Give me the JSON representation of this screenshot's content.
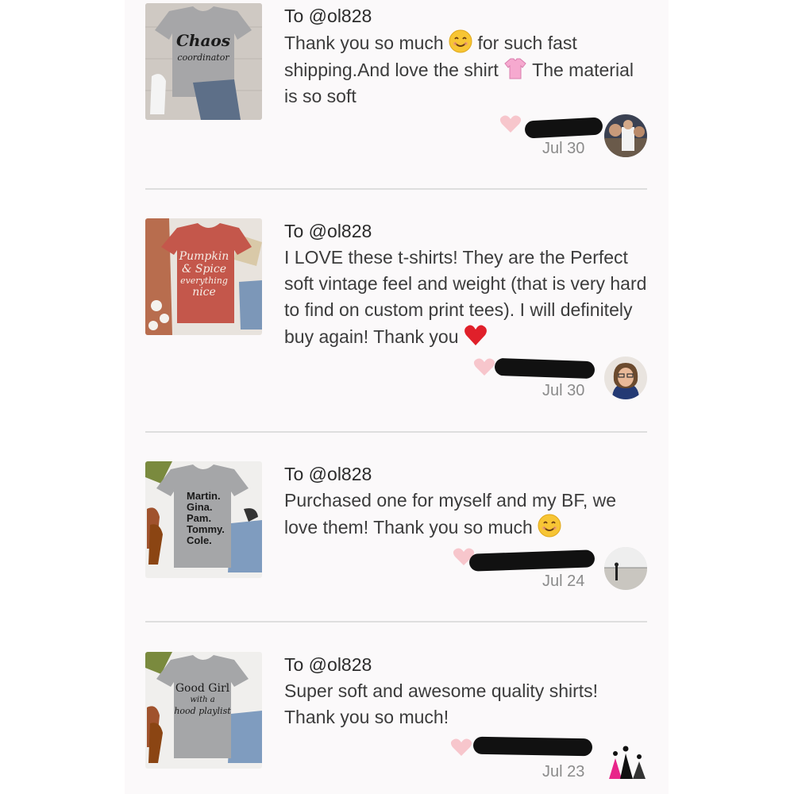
{
  "reviews": [
    {
      "to": "To @ol828",
      "text_parts": [
        "Thank you so much",
        "for such fast shipping.And love the shirt",
        "The material is so soft"
      ],
      "date": "Jul 30",
      "thumb_text": [
        "Chaos",
        "coordinator"
      ],
      "avatar": "person-with-group-avatar"
    },
    {
      "to": "To @ol828",
      "text_parts": [
        "I LOVE these t-shirts! They are the Perfect soft vintage feel and weight (that is very hard to find on custom print tees). I will definitely buy again! Thank you"
      ],
      "date": "Jul 30",
      "thumb_text": [
        "Pumpkin",
        "& Spice",
        "everything",
        "nice"
      ],
      "avatar": "woman-with-glasses-avatar"
    },
    {
      "to": "To @ol828",
      "text_parts": [
        "Purchased one for myself and my BF, we love them! Thank you so much"
      ],
      "date": "Jul 24",
      "thumb_text": [
        "Martin.",
        "Gina.",
        "Pam.",
        "Tommy.",
        "Cole."
      ],
      "avatar": "beach-person-avatar"
    },
    {
      "to": "To @ol828",
      "text_parts": [
        "Super soft and awesome quality shirts! Thank you so much!"
      ],
      "date": "Jul 23",
      "thumb_text": [
        "Good Girl",
        "with a",
        "hood playlist"
      ],
      "avatar": "dresses-silhouette-avatar"
    }
  ],
  "colors": {
    "heart": "#f7c6cc",
    "redaction": "#111111",
    "divider": "#dedede"
  }
}
